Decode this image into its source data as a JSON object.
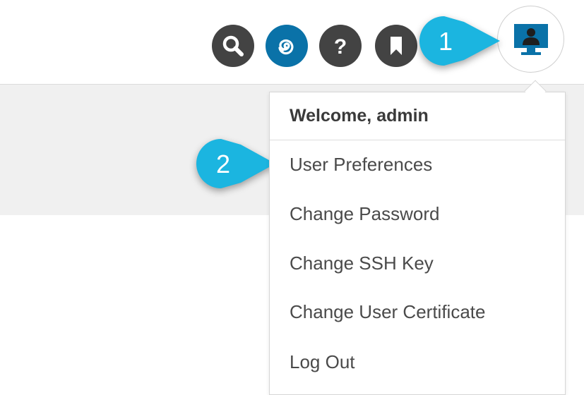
{
  "toolbar": {
    "buttons": [
      {
        "name": "search",
        "icon": "search-icon",
        "color": "#434343"
      },
      {
        "name": "ai-assistant",
        "icon": "spiral-icon",
        "color": "#0a72a8"
      },
      {
        "name": "help",
        "icon": "question-icon",
        "color": "#434343"
      },
      {
        "name": "bookmark",
        "icon": "bookmark-icon",
        "color": "#434343"
      }
    ],
    "user_button": {
      "icon": "user-profile-icon",
      "accent": "#0a72a8"
    }
  },
  "callouts": [
    {
      "number": "1",
      "color": "#1bb5e0"
    },
    {
      "number": "2",
      "color": "#1bb5e0"
    }
  ],
  "user_menu": {
    "welcome": "Welcome, admin",
    "items": [
      {
        "label": "User Preferences"
      },
      {
        "label": "Change Password"
      },
      {
        "label": "Change SSH Key"
      },
      {
        "label": "Change User Certificate"
      },
      {
        "label": "Log Out"
      }
    ]
  }
}
